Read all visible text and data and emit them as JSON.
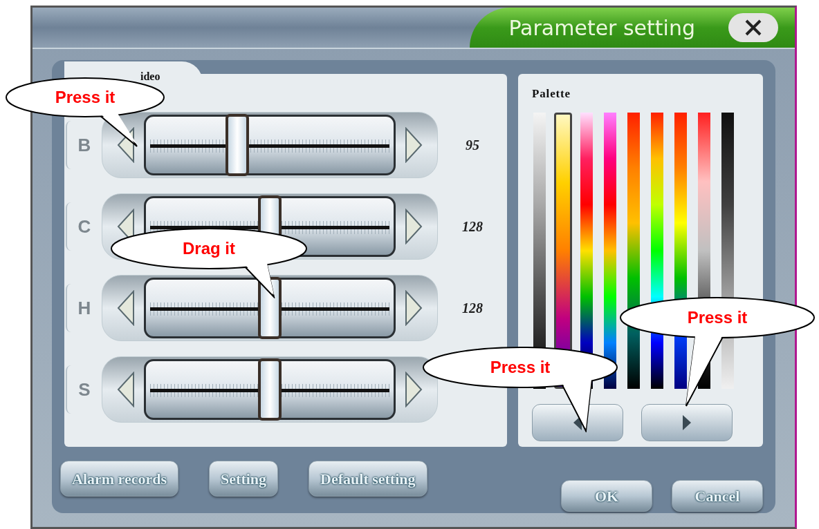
{
  "window": {
    "title": "Parameter setting"
  },
  "video_panel": {
    "tab_label": "ideo",
    "sliders": [
      {
        "letter": "B",
        "level": 0.37,
        "reading": "95"
      },
      {
        "letter": "C",
        "level": 0.5,
        "reading": "128"
      },
      {
        "letter": "H",
        "level": 0.5,
        "reading": "128"
      },
      {
        "letter": "S",
        "level": 0.5
      }
    ]
  },
  "palette_panel": {
    "title": "Palette",
    "swatches": [
      {
        "selected": false,
        "kind": "whitetoblack"
      },
      {
        "selected": true,
        "kind": "yellowtoblue"
      },
      {
        "selected": false,
        "kind": "pinkspectrum"
      },
      {
        "selected": false,
        "kind": "magentaspectrum"
      },
      {
        "selected": false,
        "kind": "redtoteal"
      },
      {
        "selected": false,
        "kind": "fullspectrum"
      },
      {
        "selected": false,
        "kind": "redtonavy"
      },
      {
        "selected": false,
        "kind": "redtogray"
      },
      {
        "selected": false,
        "kind": "blacktowhite"
      }
    ]
  },
  "bottom_buttons": [
    "Alarm records",
    "Setting",
    "Default setting"
  ],
  "dialog_buttons": [
    "OK",
    "Cancel"
  ],
  "callouts": [
    {
      "text": "Press it"
    },
    {
      "text": "Drag it"
    },
    {
      "text": "Press it"
    },
    {
      "text": "Press it"
    }
  ]
}
